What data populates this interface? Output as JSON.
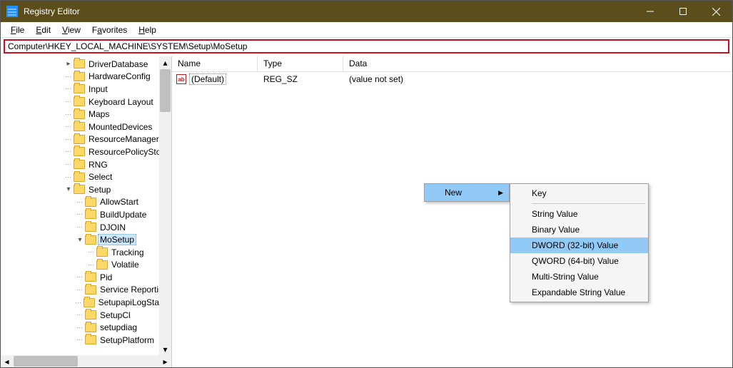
{
  "window": {
    "title": "Registry Editor"
  },
  "menu": {
    "file": "File",
    "edit": "Edit",
    "view": "View",
    "favorites": "Favorites",
    "help": "Help"
  },
  "path": "Computer\\HKEY_LOCAL_MACHINE\\SYSTEM\\Setup\\MoSetup",
  "valueColumns": {
    "name": "Name",
    "type": "Type",
    "data": "Data"
  },
  "valueRow": {
    "name": "(Default)",
    "type": "REG_SZ",
    "data": "(value not set)"
  },
  "tree": {
    "items": [
      {
        "indent": 3,
        "chev": "closed",
        "label": "DriverDatabase"
      },
      {
        "indent": 3,
        "chev": "none",
        "label": "HardwareConfig"
      },
      {
        "indent": 3,
        "chev": "none",
        "label": "Input"
      },
      {
        "indent": 3,
        "chev": "none",
        "label": "Keyboard Layout"
      },
      {
        "indent": 3,
        "chev": "none",
        "label": "Maps"
      },
      {
        "indent": 3,
        "chev": "none",
        "label": "MountedDevices"
      },
      {
        "indent": 3,
        "chev": "none",
        "label": "ResourceManager"
      },
      {
        "indent": 3,
        "chev": "none",
        "label": "ResourcePolicyStore"
      },
      {
        "indent": 3,
        "chev": "none",
        "label": "RNG"
      },
      {
        "indent": 3,
        "chev": "none",
        "label": "Select"
      },
      {
        "indent": 3,
        "chev": "open",
        "label": "Setup"
      },
      {
        "indent": 4,
        "chev": "none",
        "label": "AllowStart"
      },
      {
        "indent": 4,
        "chev": "none",
        "label": "BuildUpdate"
      },
      {
        "indent": 4,
        "chev": "none",
        "label": "DJOIN"
      },
      {
        "indent": 4,
        "chev": "open",
        "label": "MoSetup",
        "selected": true
      },
      {
        "indent": 5,
        "chev": "none",
        "label": "Tracking"
      },
      {
        "indent": 5,
        "chev": "none",
        "label": "Volatile"
      },
      {
        "indent": 4,
        "chev": "none",
        "label": "Pid"
      },
      {
        "indent": 4,
        "chev": "none",
        "label": "Service Reporting"
      },
      {
        "indent": 4,
        "chev": "none",
        "label": "SetupapiLogStatus"
      },
      {
        "indent": 4,
        "chev": "none",
        "label": "SetupCl"
      },
      {
        "indent": 4,
        "chev": "none",
        "label": "setupdiag"
      },
      {
        "indent": 4,
        "chev": "none",
        "label": "SetupPlatform"
      }
    ]
  },
  "context": {
    "new": "New",
    "items": [
      {
        "label": "Key",
        "sepAfter": true
      },
      {
        "label": "String Value"
      },
      {
        "label": "Binary Value"
      },
      {
        "label": "DWORD (32-bit) Value",
        "highlight": true
      },
      {
        "label": "QWORD (64-bit) Value"
      },
      {
        "label": "Multi-String Value"
      },
      {
        "label": "Expandable String Value"
      }
    ]
  }
}
